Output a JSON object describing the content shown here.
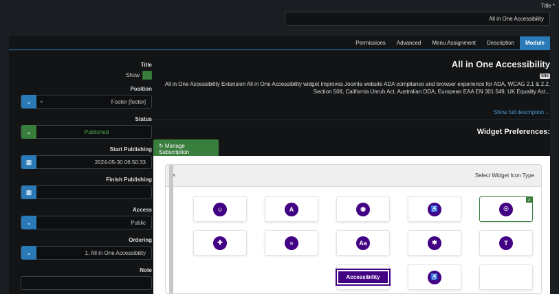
{
  "title_field": {
    "label": "Title *",
    "value": "All in One Accessibility"
  },
  "tabs": [
    {
      "label": "Module",
      "active": true
    },
    {
      "label": "Description",
      "active": false
    },
    {
      "label": "Menu Assignment",
      "active": false
    },
    {
      "label": "Advanced",
      "active": false
    },
    {
      "label": "Permissions",
      "active": false
    }
  ],
  "sidebar": {
    "title_label": "Title",
    "show_label": "Show",
    "position_label": "Position",
    "position_value": "Footer [footer]",
    "status_label": "Status",
    "status_value": "Published",
    "start_label": "Start Publishing",
    "start_value": "2024-05-30 06:50:33",
    "finish_label": "Finish Publishing",
    "finish_value": "",
    "access_label": "Access",
    "access_value": "Public",
    "ordering_label": "Ordering",
    "ordering_value": "1. All in One Accessibility",
    "note_label": "Note"
  },
  "main": {
    "module_title": "All in One Accessibility",
    "badge": "Site",
    "description": "All in One Accessibility Extension All in One Accessibility widget improves Joomla website ADA compliance and browser experience for ADA, WCAG 2.1 & 2.2, Section 508, California Unruh Act, Australian DDA, European EAA EN 301 549, UK Equality Act...",
    "show_more": "Show full description ...",
    "widget_prefs_title": "Widget Preferences:",
    "manage_button": "↻ Manage Subscription",
    "select_icon_header": "Select Widget Icon Type",
    "accessibility_button_label": "Accessibility"
  },
  "icons": [
    {
      "name": "accessibility-person-icon",
      "glyph": "☉",
      "selected": true
    },
    {
      "name": "wheelchair-icon",
      "glyph": "♿",
      "selected": false
    },
    {
      "name": "eye-icon",
      "glyph": "◉",
      "selected": false
    },
    {
      "name": "text-size-icon",
      "glyph": "A",
      "selected": false
    },
    {
      "name": "person-icon",
      "glyph": "☺",
      "selected": false
    },
    {
      "name": "text-tt-icon",
      "glyph": "T",
      "selected": false
    },
    {
      "name": "gear-icon",
      "glyph": "✱",
      "selected": false
    },
    {
      "name": "contrast-aa-icon",
      "glyph": "Aa",
      "selected": false
    },
    {
      "name": "sliders-icon",
      "glyph": "≡",
      "selected": false
    },
    {
      "name": "lifebuoy-icon",
      "glyph": "✚",
      "selected": false
    },
    {
      "name": "wheelchair-circle-icon",
      "glyph": "♿",
      "selected": false
    }
  ],
  "colors": {
    "accent_blue": "#2a7ab8",
    "accent_green": "#3a7e3e",
    "brand_purple": "#420083",
    "background": "#1a1d21"
  }
}
